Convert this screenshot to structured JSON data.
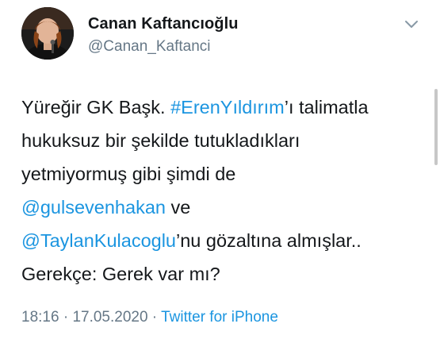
{
  "author": {
    "name": "Canan Kaftancıoğlu",
    "handle": "@Canan_Kaftanci"
  },
  "tweet": {
    "line1": {
      "text_a": "Yüreğir GK Başk. ",
      "hashtag": "#ErenYıldırım",
      "text_b": "’ı talimatla"
    },
    "line2": "hukuksuz bir şekilde tutukladıkları",
    "line3": "yetmiyormuş gibi şimdi de",
    "line4": {
      "mention": "@gulsevenhakan",
      "text": " ve"
    },
    "line5": {
      "mention": "@TaylanKulacoglu",
      "text": "’nu gözaltına almışlar.."
    },
    "line6": "Gerekçe: Gerek var mı?"
  },
  "meta": {
    "time": "18:16",
    "separator1": " · ",
    "date": "17.05.2020",
    "separator2": " · ",
    "source": "Twitter for iPhone"
  },
  "icons": {
    "more": "chevron-down-icon"
  },
  "colors": {
    "text": "#14171a",
    "secondary": "#657786",
    "link": "#1b95e0",
    "background": "#ffffff"
  }
}
